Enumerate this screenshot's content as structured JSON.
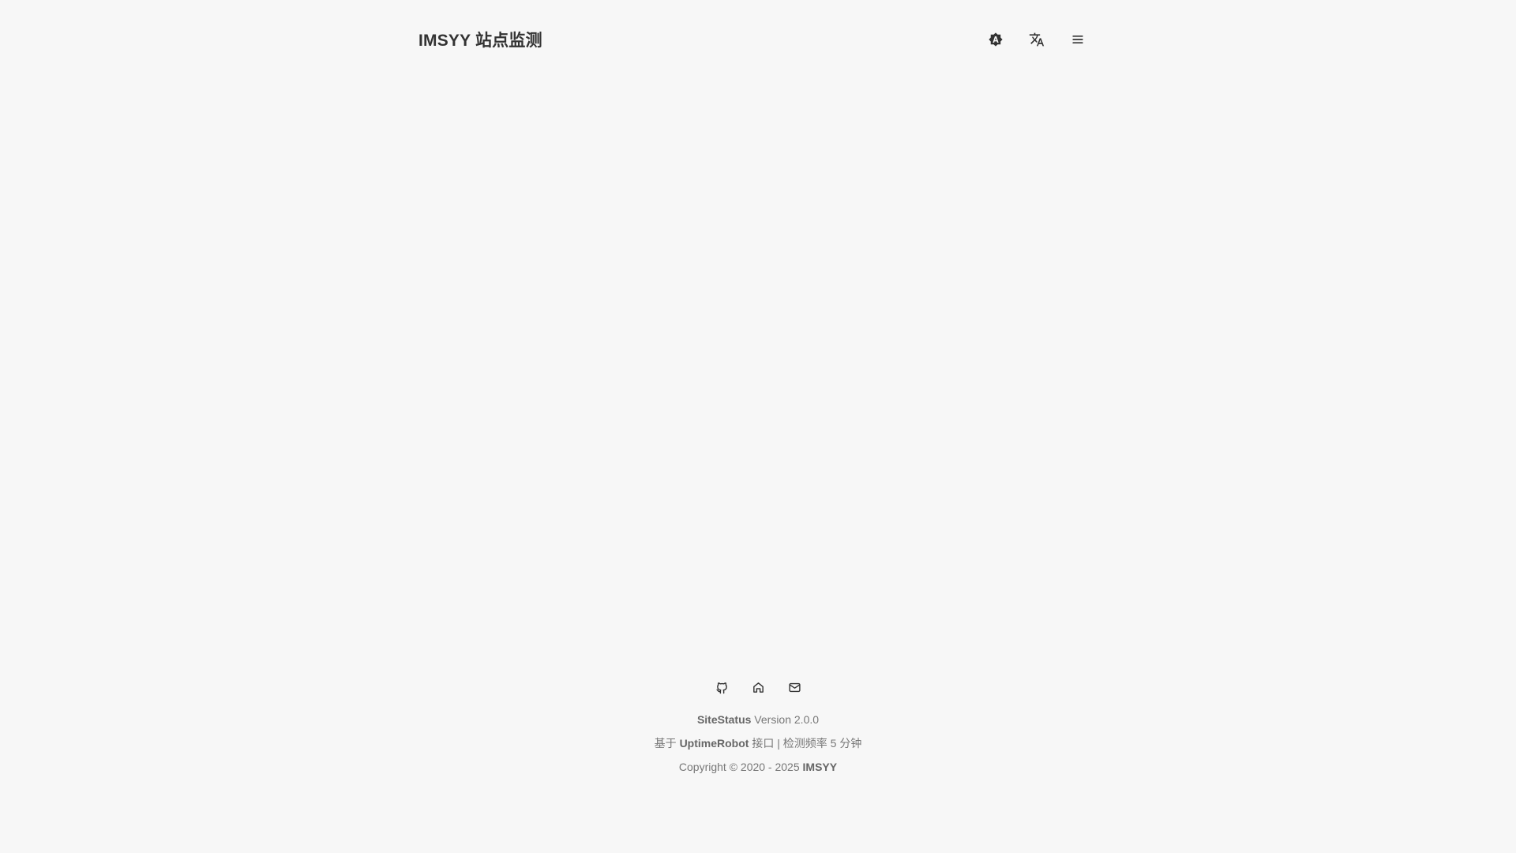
{
  "header": {
    "title": "IMSYY 站点监测",
    "actions": [
      {
        "name": "theme-toggle",
        "icon": "auto-theme-icon"
      },
      {
        "name": "language-switch",
        "icon": "translate-icon"
      },
      {
        "name": "menu",
        "icon": "menu-icon"
      }
    ]
  },
  "footer": {
    "links": [
      {
        "icon": "github-icon"
      },
      {
        "icon": "home-icon"
      },
      {
        "icon": "mail-icon"
      }
    ],
    "version": {
      "product": "SiteStatus",
      "text": " Version 2.0.0"
    },
    "powered": {
      "prefix": "基于 ",
      "api": "UptimeRobot",
      "suffix": " 接口 | 检测频率 5 分钟"
    },
    "copyright": {
      "prefix": "Copyright © 2020 - 2025 ",
      "owner": "IMSYY"
    }
  }
}
